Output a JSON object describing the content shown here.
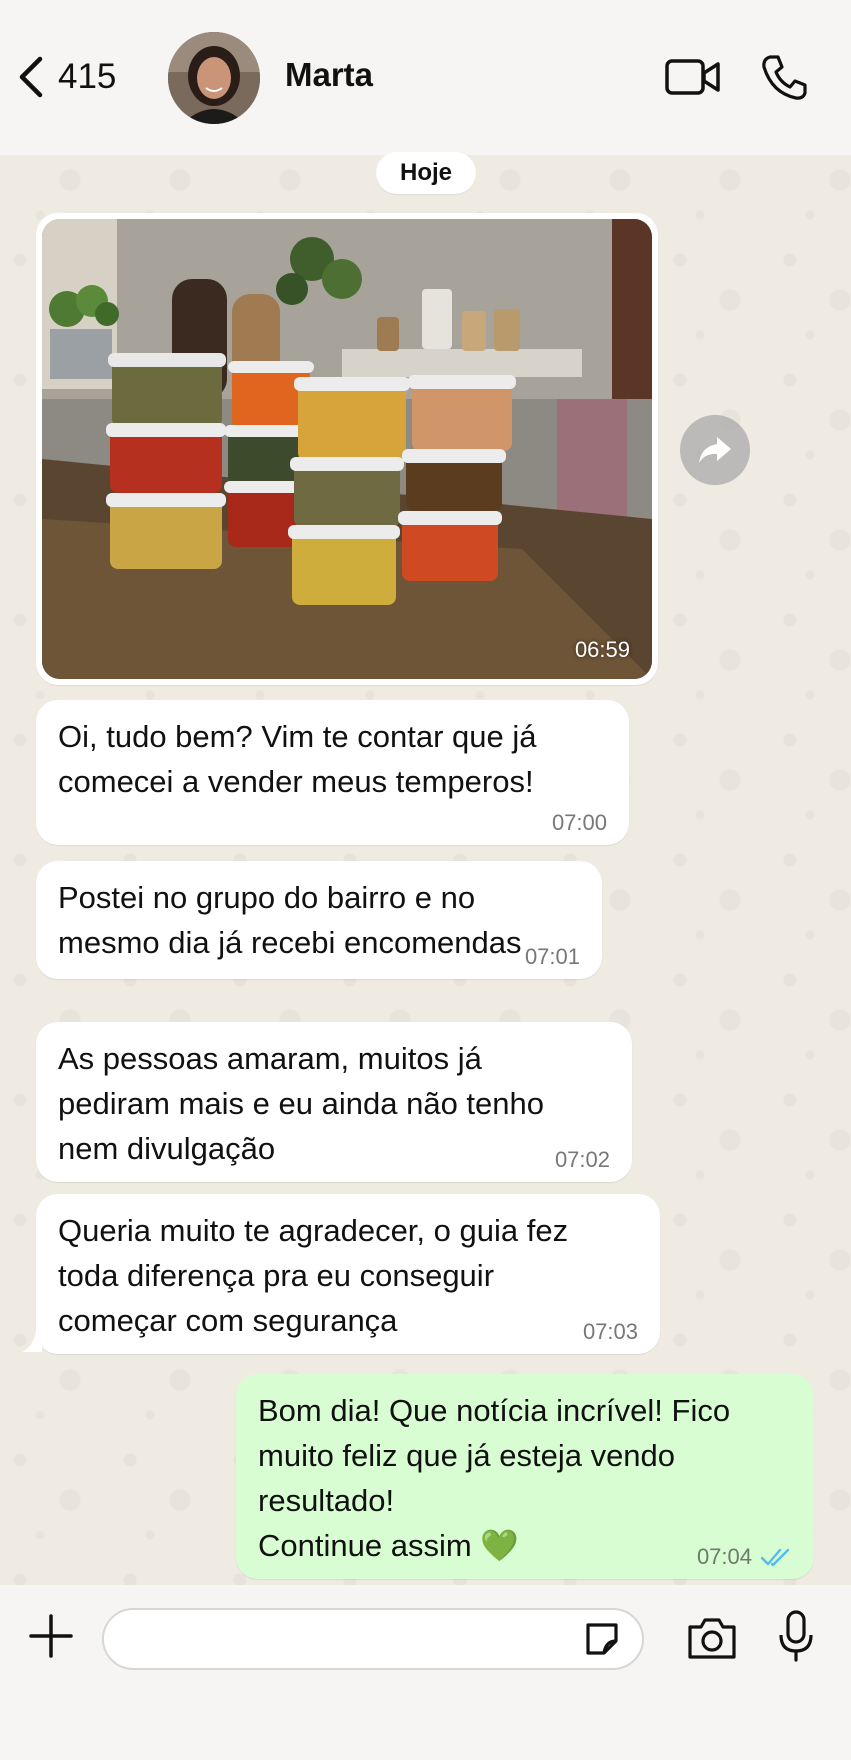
{
  "header": {
    "back_count": "415",
    "contact_name": "Marta"
  },
  "chat": {
    "date_label": "Hoje",
    "image_message": {
      "time": "06:59"
    },
    "messages": [
      {
        "direction": "in",
        "text": "Oi, tudo bem? Vim te contar que já\ncomecei a vender meus temperos!",
        "time": "07:00"
      },
      {
        "direction": "in",
        "text": "Postei no grupo do bairro e no\nmesmo dia já recebi encomendas",
        "time": "07:01"
      },
      {
        "direction": "in",
        "text": "As pessoas amaram, muitos já\npediram mais e eu ainda não tenho\nnem divulgação",
        "time": "07:02"
      },
      {
        "direction": "in",
        "text": "Queria muito te agradecer, o guia fez\ntoda diferença pra eu conseguir\ncomeçar com segurança",
        "time": "07:03"
      },
      {
        "direction": "out",
        "text": "Bom dia! Que notícia incrível! Fico\nmuito feliz que já esteja vendo\nresultado!\nContinue assim 💚",
        "time": "07:04",
        "status": "read"
      }
    ]
  },
  "composer": {
    "placeholder": ""
  },
  "colors": {
    "wallpaper": "#efeae2",
    "incoming_bubble": "#ffffff",
    "outgoing_bubble": "#d9fdd3",
    "read_ticks": "#53bdeb"
  },
  "icons": [
    "chevron-left-icon",
    "video-camera-icon",
    "phone-icon",
    "forward-icon",
    "plus-icon",
    "sticker-icon",
    "camera-icon",
    "microphone-icon",
    "double-check-icon"
  ]
}
